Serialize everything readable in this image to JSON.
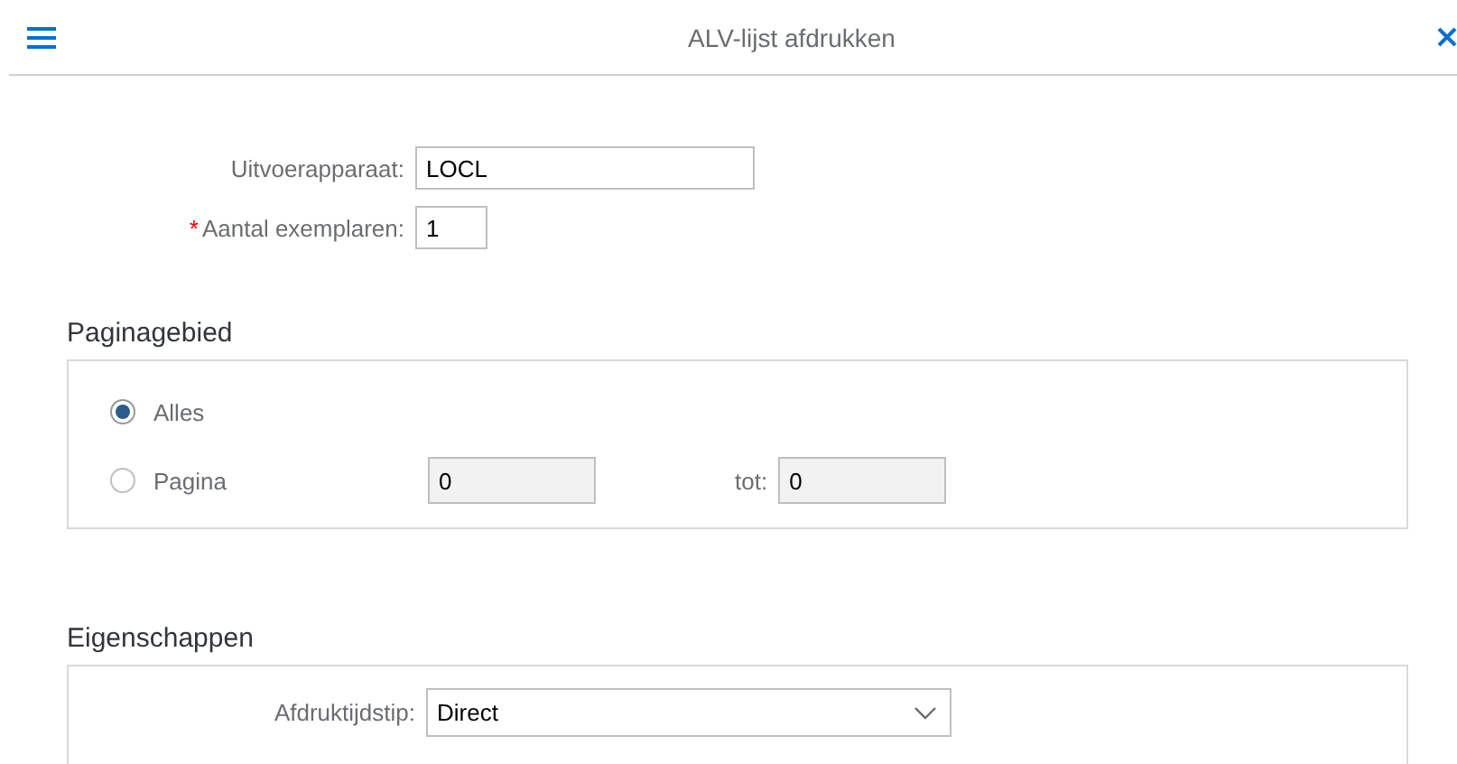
{
  "header": {
    "title": "ALV-lijst afdrukken"
  },
  "fields": [
    {
      "kind": "wide",
      "label": "Uitvoerapparaat:",
      "value": "LOCL"
    },
    {
      "kind": "narrow",
      "required_mark": "*",
      "label": "Aantal exemplaren:",
      "value": "1"
    }
  ],
  "page_range": {
    "heading": "Paginagebied",
    "options": [
      {
        "label": "Alles",
        "selected": true
      },
      {
        "label": "Pagina",
        "selected": false
      }
    ],
    "from_value": "0",
    "to_label": "tot:",
    "to_value": "0"
  },
  "properties": {
    "heading": "Eigenschappen",
    "field": {
      "label": "Afdruktijdstip:",
      "value": "Direct"
    }
  }
}
